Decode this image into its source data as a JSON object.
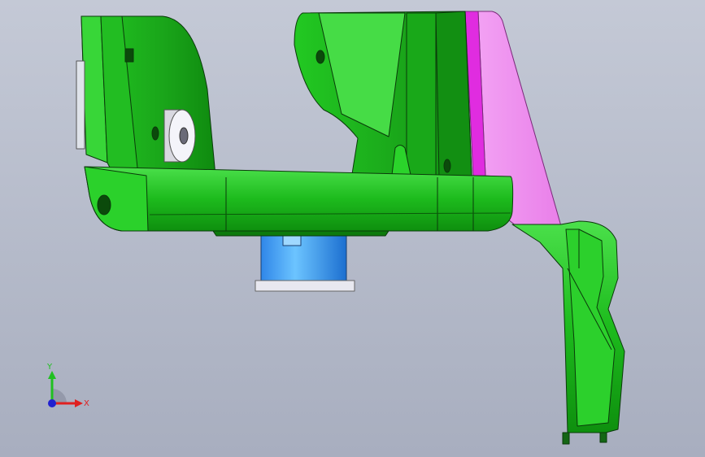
{
  "viewport": {
    "background_top": "#c2c7d4",
    "background_bottom": "#a9afc0"
  },
  "model": {
    "parts": [
      {
        "name": "mounting-bracket",
        "color": "#1fbf1f"
      },
      {
        "name": "angled-arm",
        "color": "#22c022"
      },
      {
        "name": "side-plate",
        "color": "#ef8ff0"
      },
      {
        "name": "cylindrical-boss",
        "color": "#4aa8ff"
      },
      {
        "name": "washer",
        "color": "#e8e8f0"
      }
    ]
  },
  "triad": {
    "x_label": "X",
    "y_label": "Y",
    "x_color": "#e02020",
    "y_color": "#20c020",
    "origin_color": "#2020d0"
  }
}
